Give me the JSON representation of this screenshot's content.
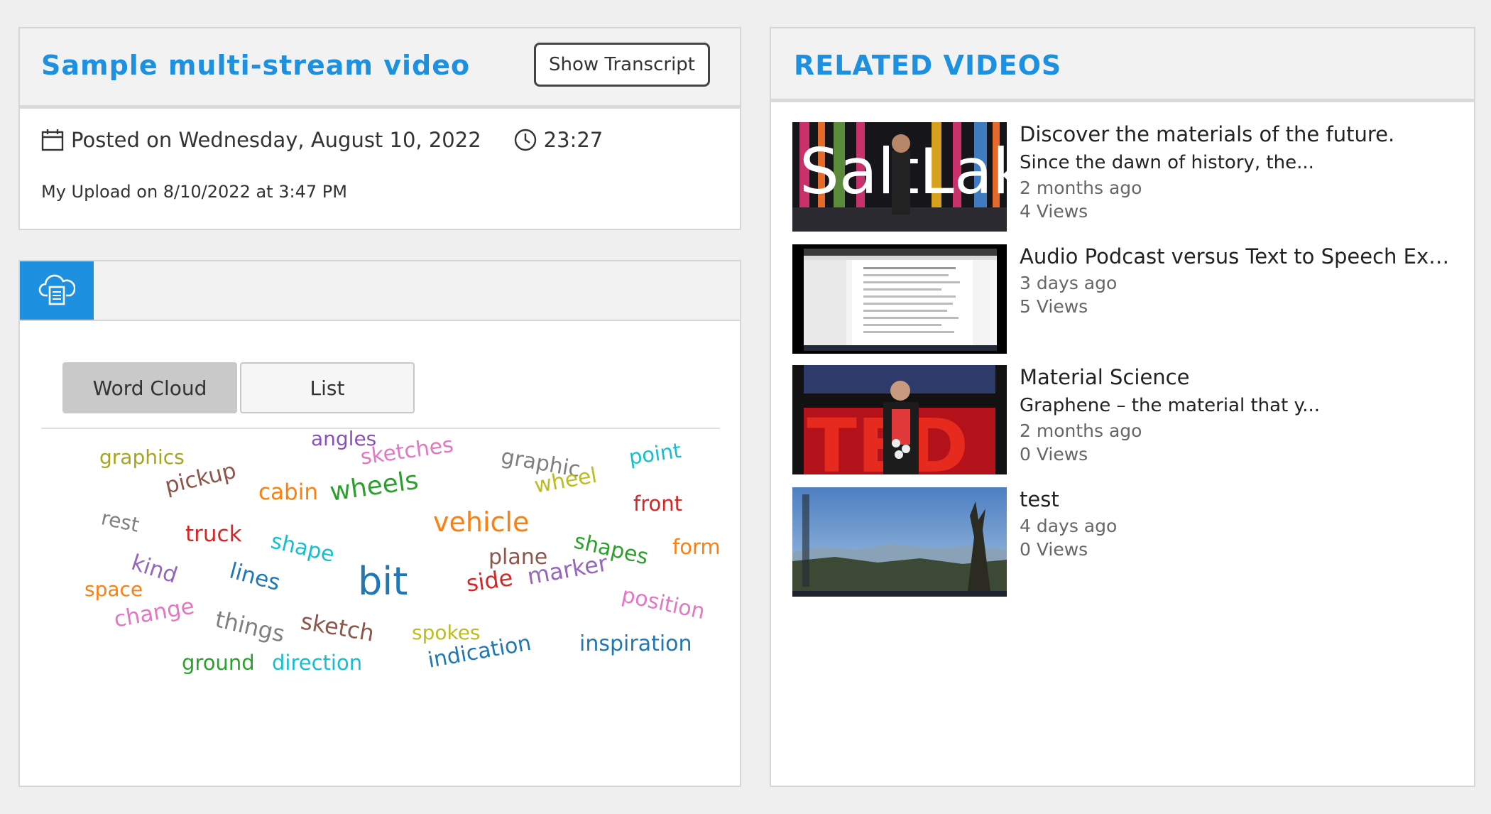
{
  "video": {
    "title": "Sample multi-stream video",
    "show_transcript_label": "Show Transcript",
    "posted": "Posted on Wednesday, August 10, 2022",
    "duration": "23:27",
    "upload_line": "My Upload on 8/10/2022 at 3:47 PM"
  },
  "icons": {
    "calendar": "calendar-icon",
    "clock": "clock-icon",
    "transcript_tab": "cloud-document-icon"
  },
  "transcript": {
    "word_cloud_label": "Word Cloud",
    "list_label": "List",
    "selected_view": "Word Cloud",
    "words": [
      {
        "text": "graphics",
        "color": "#a6a61e"
      },
      {
        "text": "angles",
        "color": "#8a52b8"
      },
      {
        "text": "sketches",
        "color": "#e377c2"
      },
      {
        "text": "graphic",
        "color": "#7f7f7f"
      },
      {
        "text": "point",
        "color": "#17becf"
      },
      {
        "text": "pickup",
        "color": "#8c564b"
      },
      {
        "text": "cabin",
        "color": "#ff7f0e"
      },
      {
        "text": "wheels",
        "color": "#2ca02c"
      },
      {
        "text": "wheel",
        "color": "#bcbd22"
      },
      {
        "text": "front",
        "color": "#d62728"
      },
      {
        "text": "rest",
        "color": "#7f7f7f"
      },
      {
        "text": "vehicle",
        "color": "#ff7f0e"
      },
      {
        "text": "truck",
        "color": "#d62728"
      },
      {
        "text": "shape",
        "color": "#17becf"
      },
      {
        "text": "shapes",
        "color": "#2ca02c"
      },
      {
        "text": "form",
        "color": "#ff7f0e"
      },
      {
        "text": "kind",
        "color": "#9467bd"
      },
      {
        "text": "plane",
        "color": "#8c564b"
      },
      {
        "text": "lines",
        "color": "#1f77b4"
      },
      {
        "text": "bit",
        "color": "#1f77b4"
      },
      {
        "text": "space",
        "color": "#ff7f0e"
      },
      {
        "text": "side",
        "color": "#d62728"
      },
      {
        "text": "marker",
        "color": "#9467bd"
      },
      {
        "text": "position",
        "color": "#e377c2"
      },
      {
        "text": "change",
        "color": "#e377c2"
      },
      {
        "text": "things",
        "color": "#7f7f7f"
      },
      {
        "text": "sketch",
        "color": "#8c564b"
      },
      {
        "text": "spokes",
        "color": "#bcbd22"
      },
      {
        "text": "ground",
        "color": "#2ca02c"
      },
      {
        "text": "direction",
        "color": "#17becf"
      },
      {
        "text": "inspiration",
        "color": "#1f77b4"
      },
      {
        "text": "indication",
        "color": "#1f77b4"
      }
    ]
  },
  "related": {
    "heading": "RELATED VIDEOS",
    "items": [
      {
        "title": "Discover the materials of the future.",
        "description": "Since the dawn of history, the...",
        "age": "2 months ago",
        "views": "4 Views",
        "thumb_text": "SaltLak"
      },
      {
        "title": "Audio Podcast versus Text to Speech Exa...",
        "description": "",
        "age": "3 days ago",
        "views": "5 Views",
        "thumb_text": ""
      },
      {
        "title": "Material Science",
        "description": "Graphene – the material that y...",
        "age": "2 months ago",
        "views": "0 Views",
        "thumb_text": "TED"
      },
      {
        "title": "test",
        "description": "",
        "age": "4 days ago",
        "views": "0 Views",
        "thumb_text": ""
      }
    ]
  },
  "colors": {
    "accent": "#1e90e0",
    "page_bg": "#efefef"
  }
}
